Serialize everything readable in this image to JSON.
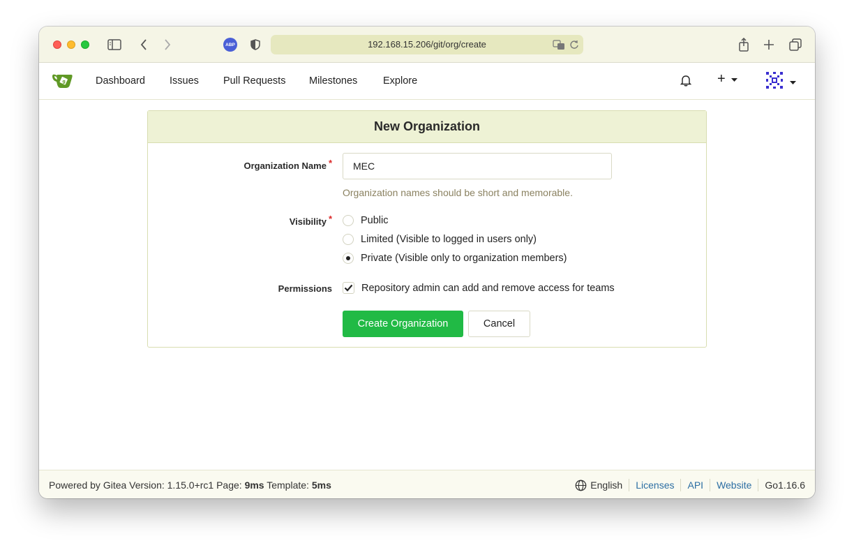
{
  "browser": {
    "url": "192.168.15.206/git/org/create",
    "abp_label": "ABP"
  },
  "nav": {
    "items": [
      "Dashboard",
      "Issues",
      "Pull Requests",
      "Milestones",
      "Explore"
    ],
    "plus_label": "+"
  },
  "form": {
    "title": "New Organization",
    "org_name_label": "Organization Name",
    "required_mark": "*",
    "org_name_value": "MEC",
    "org_name_help": "Organization names should be short and memorable.",
    "visibility_label": "Visibility",
    "visibility_options": [
      {
        "label": "Public",
        "checked": false
      },
      {
        "label": "Limited (Visible to logged in users only)",
        "checked": false
      },
      {
        "label": "Private (Visible only to organization members)",
        "checked": true
      }
    ],
    "permissions_label": "Permissions",
    "permissions_option": "Repository admin can add and remove access for teams",
    "permissions_checked": true,
    "create_button": "Create Organization",
    "cancel_button": "Cancel"
  },
  "footer": {
    "powered_prefix": "Powered by Gitea Version: 1.15.0+rc1 Page:",
    "page_time": "9ms",
    "template_prefix": "Template:",
    "template_time": "5ms",
    "language": "English",
    "licenses": "Licenses",
    "api": "API",
    "website": "Website",
    "go_version": "Go1.16.6"
  },
  "colors": {
    "primary_green": "#21ba45",
    "panel_header": "#eef2d5",
    "link": "#2c6ea3",
    "url_bar": "#e6e8bf"
  }
}
